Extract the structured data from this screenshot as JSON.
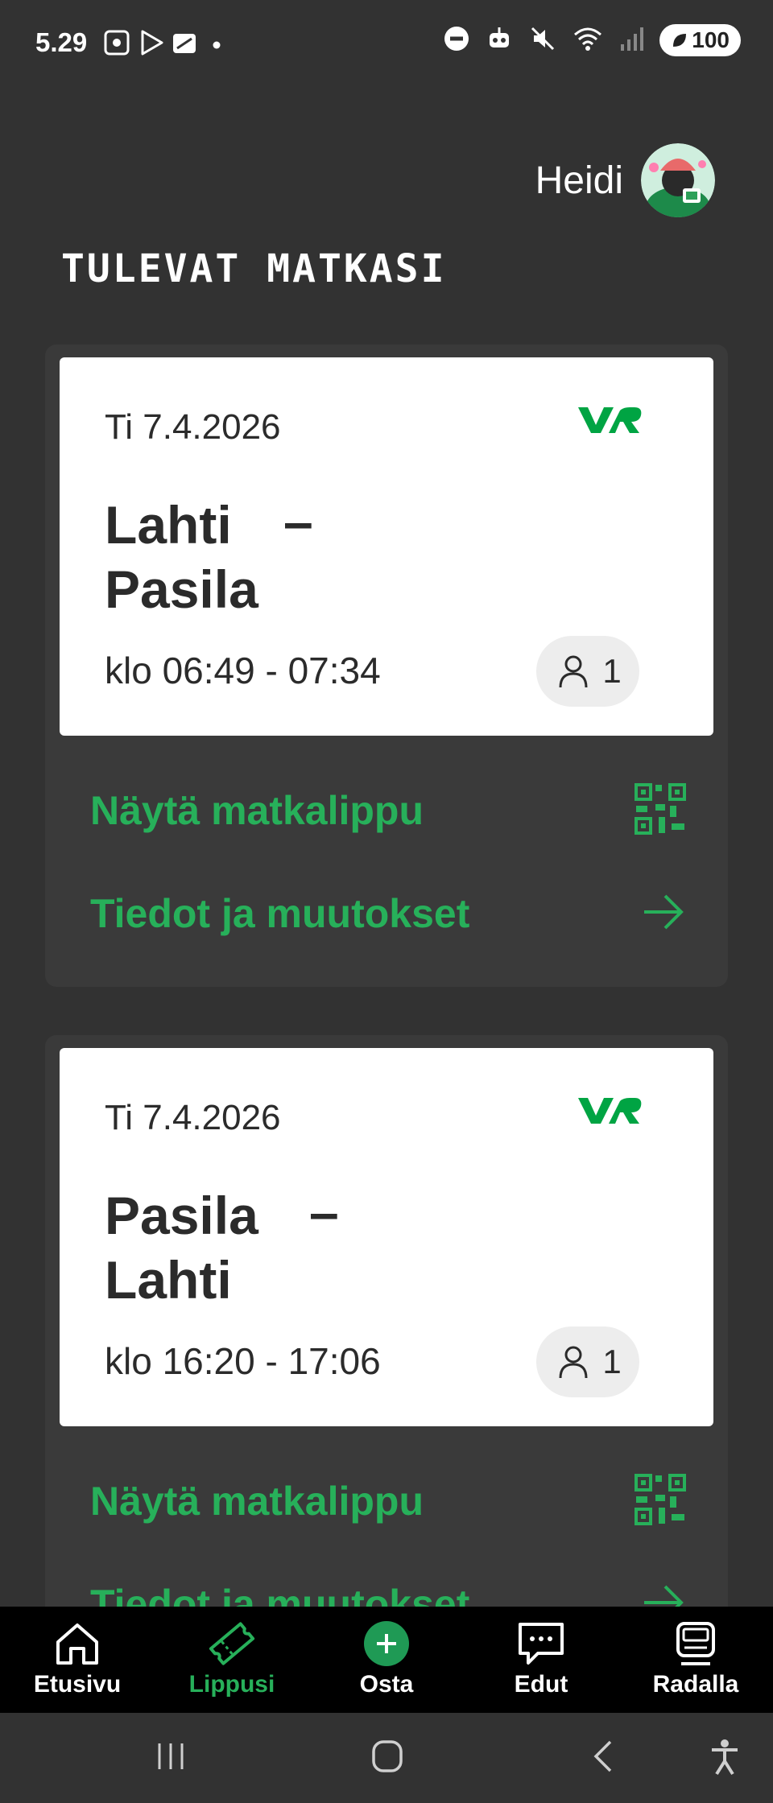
{
  "status_bar": {
    "time": "5.29",
    "battery": "100"
  },
  "user": {
    "name": "Heidi"
  },
  "section_title": "TULEVAT MATKASI",
  "brand_logo": "VR",
  "trips": [
    {
      "date": "Ti 7.4.2026",
      "from": "Lahti",
      "dash": "–",
      "to": "Pasila",
      "time": "klo 06:49 - 07:34",
      "passengers": "1",
      "show_ticket_label": "Näytä matkalippu",
      "details_label": "Tiedot ja muutokset"
    },
    {
      "date": "Ti 7.4.2026",
      "from": "Pasila",
      "dash": "–",
      "to": "Lahti",
      "time": "klo 16:20 - 17:06",
      "passengers": "1",
      "show_ticket_label": "Näytä matkalippu",
      "details_label": "Tiedot ja muutokset"
    }
  ],
  "bottom_nav": [
    {
      "label": "Etusivu",
      "icon": "home-icon"
    },
    {
      "label": "Lippusi",
      "icon": "ticket-icon",
      "active": true
    },
    {
      "label": "Osta",
      "icon": "plus-circle-icon"
    },
    {
      "label": "Edut",
      "icon": "chat-bubble-icon"
    },
    {
      "label": "Radalla",
      "icon": "train-icon"
    }
  ],
  "colors": {
    "accent_green": "#27b05a",
    "background": "#323232",
    "card": "#3a3a3a"
  }
}
